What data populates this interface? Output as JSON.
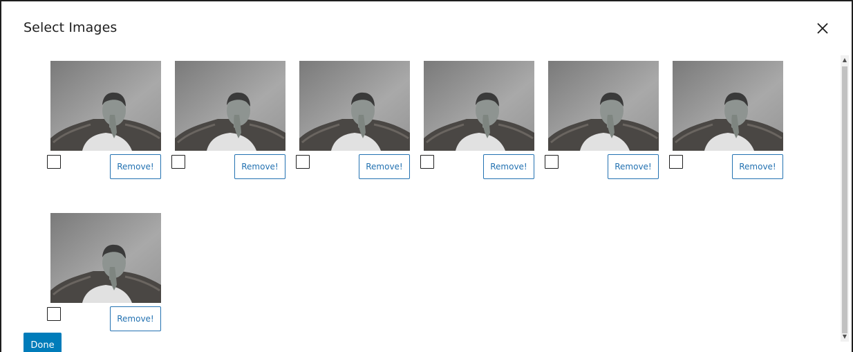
{
  "dialog": {
    "title": "Select Images",
    "close_icon": "close-icon",
    "done_label": "Done"
  },
  "images": [
    {
      "checked": false,
      "remove_label": "Remove!"
    },
    {
      "checked": false,
      "remove_label": "Remove!"
    },
    {
      "checked": false,
      "remove_label": "Remove!"
    },
    {
      "checked": false,
      "remove_label": "Remove!"
    },
    {
      "checked": false,
      "remove_label": "Remove!"
    },
    {
      "checked": false,
      "remove_label": "Remove!"
    },
    {
      "checked": false,
      "remove_label": "Remove!"
    }
  ],
  "colors": {
    "primary": "#007cba",
    "link": "#2271b1",
    "text": "#1e1e1e"
  }
}
